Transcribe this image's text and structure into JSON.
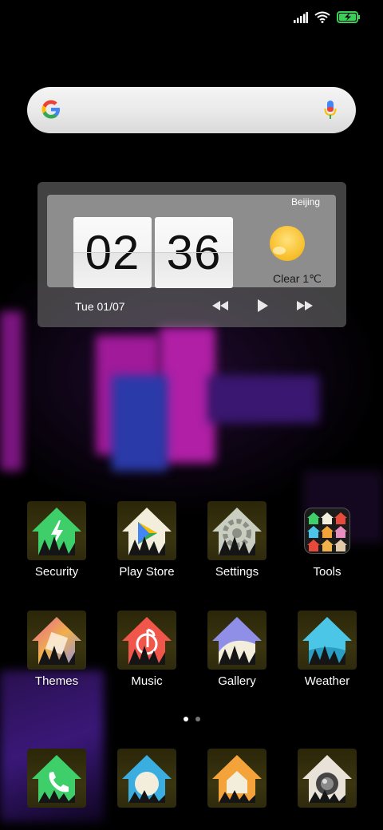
{
  "widget": {
    "city": "Beijing",
    "hour": "02",
    "minute": "36",
    "weather": "Clear  1℃",
    "date": "Tue 01/07"
  },
  "apps": [
    {
      "label": "Security",
      "icon": "security-icon",
      "color": "#3ecf6a"
    },
    {
      "label": "Play Store",
      "icon": "play-store-icon",
      "color": "#f3eedc"
    },
    {
      "label": "Settings",
      "icon": "settings-icon",
      "color": "#c9cec0"
    },
    {
      "label": "Tools",
      "icon": "tools-folder-icon",
      "color": "#222222"
    },
    {
      "label": "Themes",
      "icon": "themes-icon",
      "color": "#f0b04a"
    },
    {
      "label": "Music",
      "icon": "music-icon",
      "color": "#f0564a"
    },
    {
      "label": "Gallery",
      "icon": "gallery-icon",
      "color": "#8f8fe8"
    },
    {
      "label": "Weather",
      "icon": "weather-icon",
      "color": "#4cc6e6"
    }
  ],
  "dock": [
    {
      "icon": "phone-icon",
      "color": "#3ecf6a"
    },
    {
      "icon": "messaging-icon",
      "color": "#3aaee0"
    },
    {
      "icon": "browser-icon",
      "color": "#f4a23a"
    },
    {
      "icon": "camera-icon",
      "color": "#e8e2d8"
    }
  ],
  "page_indicator": {
    "pages": 2,
    "current": 1
  }
}
